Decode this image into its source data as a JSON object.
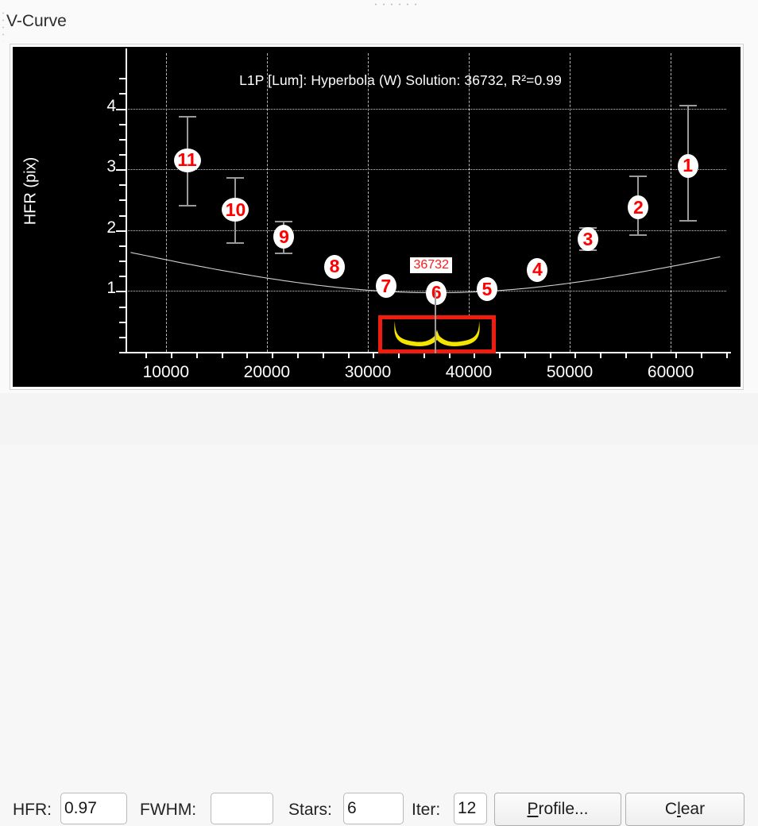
{
  "window": {
    "title": "V-Curve",
    "grip_top_icon": "horizontal-drag-grip-icon",
    "grip_left_icon": "vertical-drag-grip-icon"
  },
  "chart_data": {
    "type": "scatter",
    "title": "L1P [Lum]: Hyperbola (W) Solution: 36732, R²=0.99",
    "xlabel": "",
    "ylabel": "HFR (pix)",
    "xlim": [
      6000,
      65500
    ],
    "ylim": [
      0.0,
      4.62
    ],
    "grid": true,
    "legend": null,
    "xticks": [
      10000,
      20000,
      30000,
      40000,
      50000,
      60000
    ],
    "yticks": [
      1,
      2,
      3,
      4
    ],
    "xtick_labels": [
      "10000",
      "20000",
      "30000",
      "40000",
      "50000",
      "60000"
    ],
    "ytick_labels": [
      "1",
      "2",
      "3",
      "4"
    ],
    "solution_annotation": "36732",
    "solution_x": 36732,
    "point_labels": [
      "1",
      "2",
      "3",
      "4",
      "5",
      "6",
      "7",
      "8",
      "9",
      "10",
      "11"
    ],
    "points": [
      {
        "label": "11",
        "x": 12100,
        "y": 3.15,
        "err_low": 2.42,
        "err_high": 3.88
      },
      {
        "label": "10",
        "x": 16900,
        "y": 2.33,
        "err_low": 1.8,
        "err_high": 2.87
      },
      {
        "label": "9",
        "x": 21700,
        "y": 1.89,
        "err_low": 1.63,
        "err_high": 2.15
      },
      {
        "label": "8",
        "x": 26700,
        "y": 1.4,
        "err_low": null,
        "err_high": null
      },
      {
        "label": "7",
        "x": 31800,
        "y": 1.08,
        "err_low": null,
        "err_high": null
      },
      {
        "label": "6",
        "x": 36800,
        "y": 0.97,
        "err_low": null,
        "err_high": null
      },
      {
        "label": "5",
        "x": 41800,
        "y": 1.03,
        "err_low": null,
        "err_high": null
      },
      {
        "label": "4",
        "x": 46800,
        "y": 1.35,
        "err_low": null,
        "err_high": null
      },
      {
        "label": "3",
        "x": 51800,
        "y": 1.85,
        "err_low": 1.68,
        "err_high": 2.05
      },
      {
        "label": "2",
        "x": 56800,
        "y": 2.37,
        "err_low": 1.93,
        "err_high": 2.9
      },
      {
        "label": "1",
        "x": 61700,
        "y": 3.06,
        "err_low": 2.16,
        "err_high": 4.06
      }
    ],
    "fit_curve_name": "Hyperbola (W)",
    "r_squared": "0.99",
    "colors": {
      "background": "#000000",
      "axis": "#ffffff",
      "grid": "#b5b5b5",
      "marker_fill": "#ffffff",
      "marker_text": "#ff0000",
      "errorbar": "#9a9a9a",
      "fit_line": "#cfcfcf",
      "focus_box_border": "#f01c10",
      "focus_wave": "#f5e400"
    }
  },
  "focus_inset": {
    "name": "focus-star-profile-inset",
    "wave_icon": "w-wave-profile-icon"
  },
  "toolbar": {
    "hfr_label": "HFR:",
    "hfr_value": "0.97",
    "fwhm_label": "FWHM:",
    "fwhm_value": "",
    "stars_label": "Stars:",
    "stars_value": "6",
    "iter_label": "Iter:",
    "iter_value": "12",
    "profile_button": "Profile...",
    "profile_button_pre": "P",
    "profile_button_post": "rofile...",
    "clear_button": "Clear",
    "clear_button_pre": "C",
    "clear_button_mid": "l",
    "clear_button_post": "ear"
  }
}
